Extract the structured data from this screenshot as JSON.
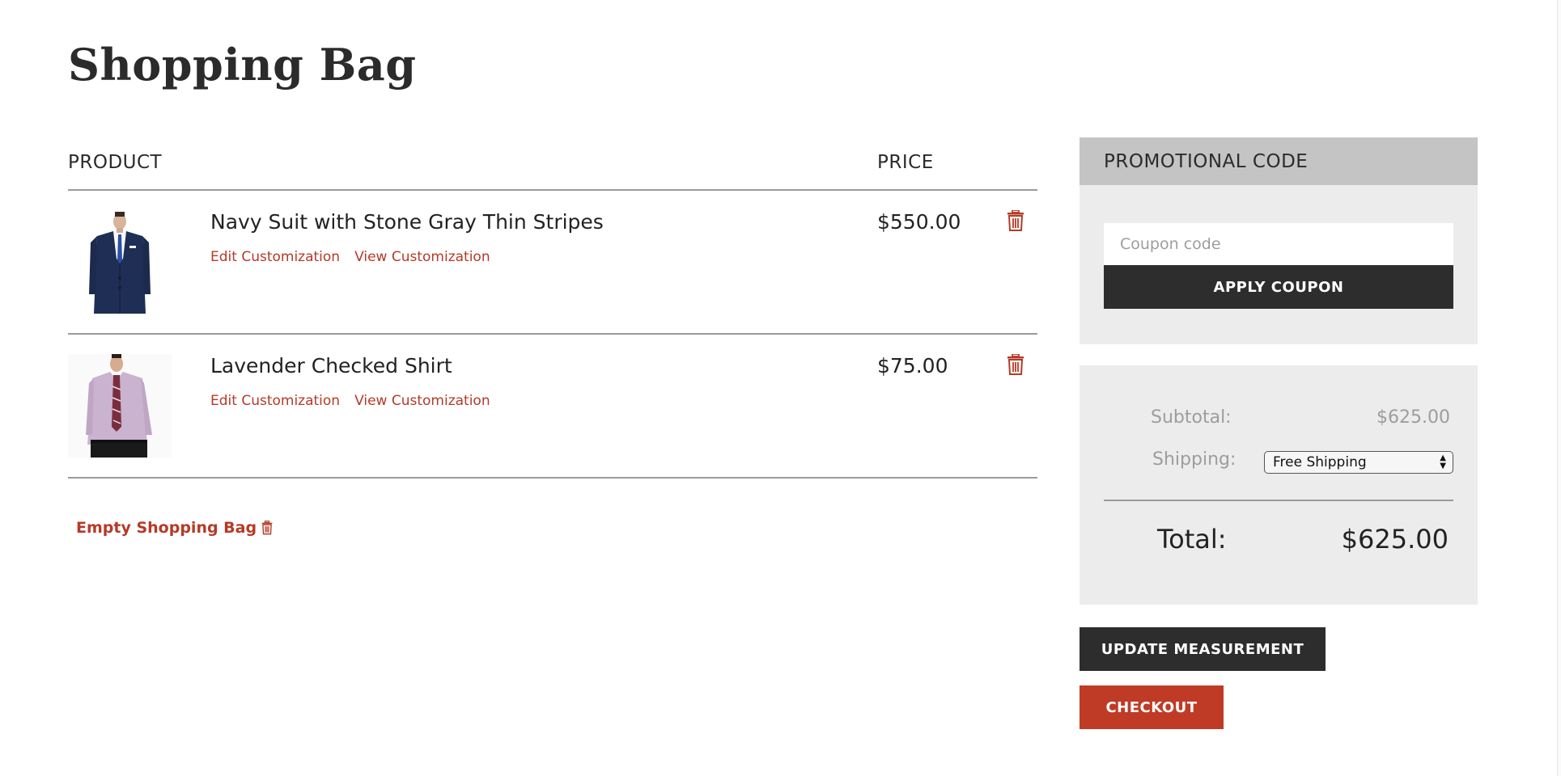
{
  "page": {
    "title": "Shopping Bag"
  },
  "cart": {
    "columns": {
      "product": "PRODUCT",
      "price": "PRICE"
    },
    "items": [
      {
        "name": "Navy Suit with Stone Gray Thin Stripes",
        "edit_label": "Edit Customization",
        "view_label": "View Customization",
        "price": "$550.00",
        "image": "navy-suit-photo"
      },
      {
        "name": "Lavender Checked Shirt",
        "edit_label": "Edit Customization",
        "view_label": "View Customization",
        "price": "$75.00",
        "image": "lavender-shirt-photo"
      }
    ],
    "empty_label": "Empty Shopping Bag"
  },
  "promo": {
    "heading": "PROMOTIONAL CODE",
    "placeholder": "Coupon code",
    "value": "",
    "apply_label": "APPLY COUPON"
  },
  "summary": {
    "subtotal_label": "Subtotal:",
    "subtotal_value": "$625.00",
    "shipping_label": "Shipping:",
    "shipping_selected": "Free Shipping",
    "total_label": "Total:",
    "total_value": "$625.00"
  },
  "actions": {
    "update_label": "UPDATE MEASUREMENT",
    "checkout_label": "CHECKOUT"
  },
  "colors": {
    "accent": "#b53a27",
    "checkout": "#bf3b26",
    "dark_button": "#2d2d2d",
    "panel": "#ececec",
    "panel_header": "#c4c4c4"
  },
  "icons": {
    "delete": "trash-icon",
    "select": "updown-arrows-icon"
  }
}
